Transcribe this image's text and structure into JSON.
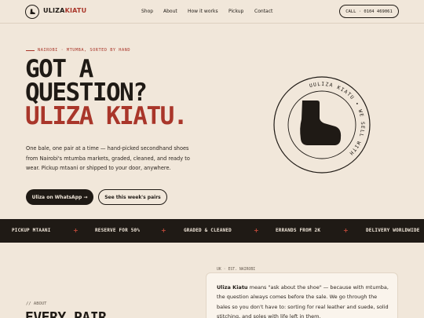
{
  "colors": {
    "background": "#f1e7da",
    "ink": "#1f1a15",
    "accent": "#a9362a",
    "card": "#faf4ec"
  },
  "nav": {
    "logo_icon": "boot-icon",
    "logo_part1": "ULIZA",
    "logo_part2": "KIATU",
    "links": [
      "Shop",
      "About",
      "How it works",
      "Pickup",
      "Contact"
    ],
    "call_label": "CALL · 0104 469061"
  },
  "hero": {
    "eyebrow": "NAIROBI · MTUMBA, SORTED BY HAND",
    "headline_line1": "GOT A",
    "headline_line2": "QUESTION?",
    "headline_line3": "ULIZA KIATU.",
    "body": "One bale, one pair at a time — hand-picked secondhand shoes from Nairobi's mtumba markets, graded, cleaned, and ready to wear. Pickup mtaani or shipped to your door, anywhere.",
    "primary_cta": "Uliza on WhatsApp →",
    "secondary_cta": "See this week's pairs"
  },
  "badge": {
    "ring_text": "UULIZA KIATU • WE SELL WITH",
    "icon": "boot-icon"
  },
  "ticker": {
    "items": [
      "PICKUP MTAANI",
      "RESERVE FOR 50%",
      "GRADED & CLEANED",
      "ERRANDS FROM 2K",
      "DELIVERY WORLDWIDE"
    ],
    "separator": "+"
  },
  "about": {
    "label": "// ABOUT",
    "heading": "EVERY PAIR",
    "card_tag": "UK · EST. NAIROBI",
    "card_name": "Uliza Kiatu",
    "card_text": " means \"ask about the shoe\" — because with mtumba, the question always comes before the sale. We go through the bales so you don't have to: sorting for real leather and suede, solid stitching, and soles with life left in them."
  }
}
